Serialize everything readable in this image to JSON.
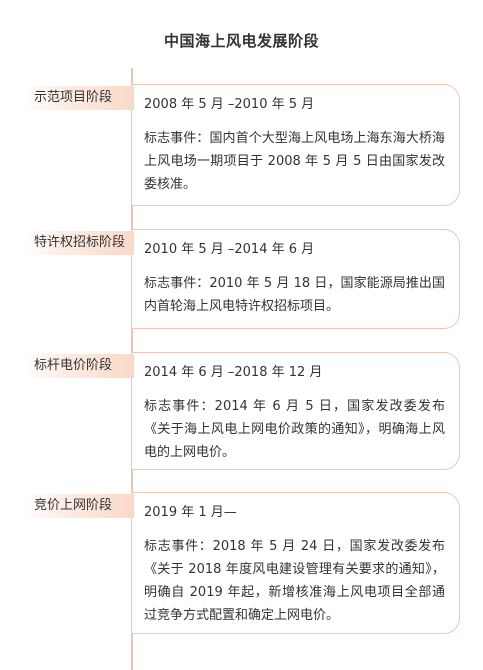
{
  "title": "中国海上风电发展阶段",
  "stages": [
    {
      "label": "示范项目阶段",
      "period": "2008 年 5 月 –2010 年 5 月",
      "event": "标志事件：国内首个大型海上风电场上海东海大桥海上风电场一期项目于 2008 年 5 月 5 日由国家发改委核准。"
    },
    {
      "label": "特许权招标阶段",
      "period": "2010 年 5 月 –2014 年 6 月",
      "event": "标志事件：2010 年 5 月 18 日，国家能源局推出国内首轮海上风电特许权招标项目。"
    },
    {
      "label": "标杆电价阶段",
      "period": "2014 年 6 月 –2018 年 12 月",
      "event": "标志事件：2014 年 6 月 5 日，国家发改委发布《关于海上风电上网电价政策的通知》，明确海上风电的上网电价。"
    },
    {
      "label": "竞价上网阶段",
      "period": "2019 年 1 月—",
      "event": "标志事件：2018 年 5 月 24 日，国家发改委发布《关于 2018 年度风电建设管理有关要求的通知》，明确自 2019 年起，新增核准海上风电项目全部通过竞争方式配置和确定上网电价。"
    }
  ]
}
